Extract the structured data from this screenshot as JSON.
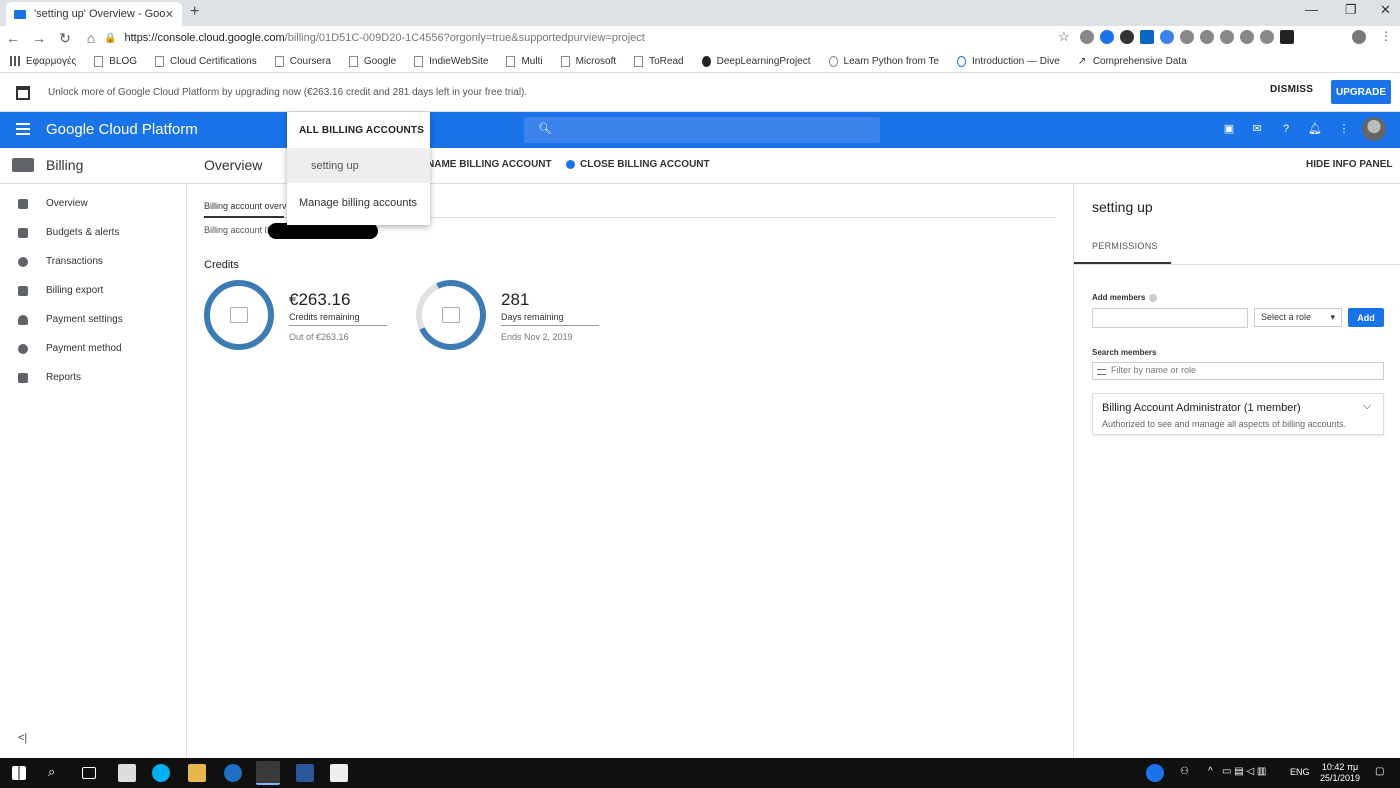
{
  "browser": {
    "tab_title": "'setting up' Overview - Google C",
    "url_host": "https://console.cloud.google.com",
    "url_rest": "/billing/01D51C-009D20-1C4556?orgonly=true&supportedpurview=project",
    "bookmarks": [
      "Εφαρμογές",
      "BLOG",
      "Cloud Certifications",
      "Coursera",
      "Google",
      "IndieWebSite",
      "Multi",
      "Microsoft",
      "ToRead",
      "DeepLearningProject",
      "Learn Python from Te",
      "Introduction — Dive",
      "Comprehensive Data"
    ]
  },
  "promo": {
    "message": "Unlock more of Google Cloud Platform by upgrading now (€263.16 credit and 281 days left in your free trial).",
    "dismiss": "DISMISS",
    "upgrade": "UPGRADE"
  },
  "header": {
    "title": "Google Cloud Platform",
    "brand_color": "#1a73e8"
  },
  "dropdown": {
    "heading": "ALL BILLING ACCOUNTS",
    "items": [
      "setting up",
      "Manage billing accounts"
    ]
  },
  "subheader": {
    "section": "Billing",
    "page_title": "Overview",
    "rename": "NAME BILLING ACCOUNT",
    "close": "CLOSE BILLING ACCOUNT",
    "hide_info": "HIDE INFO PANEL"
  },
  "sidebar": {
    "items": [
      {
        "label": "Overview",
        "icon": "dashboard-icon"
      },
      {
        "label": "Budgets & alerts",
        "icon": "budget-icon"
      },
      {
        "label": "Transactions",
        "icon": "clock-icon"
      },
      {
        "label": "Billing export",
        "icon": "export-icon"
      },
      {
        "label": "Payment settings",
        "icon": "person-icon"
      },
      {
        "label": "Payment method",
        "icon": "gear-icon"
      },
      {
        "label": "Reports",
        "icon": "bar-chart-icon"
      }
    ]
  },
  "main": {
    "tab": "Billing account overvi",
    "account_id_label": "Billing account ID",
    "credits_heading": "Credits",
    "credits_amount": "€263.16",
    "credits_label": "Credits remaining",
    "credits_out_of": "Out of €263.16",
    "days_amount": "281",
    "days_label": "Days remaining",
    "days_ends": "Ends Nov 2, 2019",
    "ring_color": "#3c7bb3"
  },
  "info_panel": {
    "title": "setting up",
    "tab": "PERMISSIONS",
    "add_members": "Add members",
    "select_role": "Select a role",
    "add_button": "Add",
    "search_members": "Search members",
    "filter_placeholder": "Filter by name or role",
    "role_title": "Billing Account Administrator (1 member)",
    "role_desc": "Authorized to see and manage all aspects of billing accounts."
  },
  "taskbar": {
    "lang": "ENG",
    "time": "10:42 πμ",
    "date": "25/1/2019"
  }
}
